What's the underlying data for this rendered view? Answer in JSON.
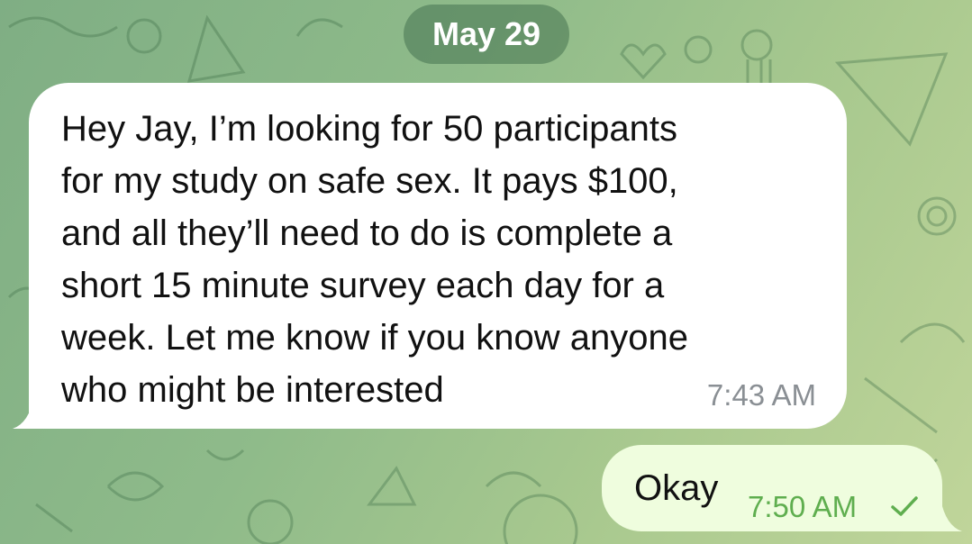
{
  "date_separator": "May 29",
  "incoming_message": {
    "text": "Hey Jay, I’m looking for 50 participants\nfor my study on safe sex. It pays $100,\nand all they’ll need to do is complete a\nshort 15 minute survey each day for a\nweek. Let me know if you know anyone\nwho might be interested",
    "time": "7:43 AM"
  },
  "outgoing_message": {
    "text": "Okay",
    "time": "7:50 AM",
    "status_icon": "single-check-icon"
  },
  "colors": {
    "incoming_bubble": "#ffffff",
    "outgoing_bubble": "#effdde",
    "outgoing_time": "#5fae4f",
    "background": "#8fbb8a"
  }
}
